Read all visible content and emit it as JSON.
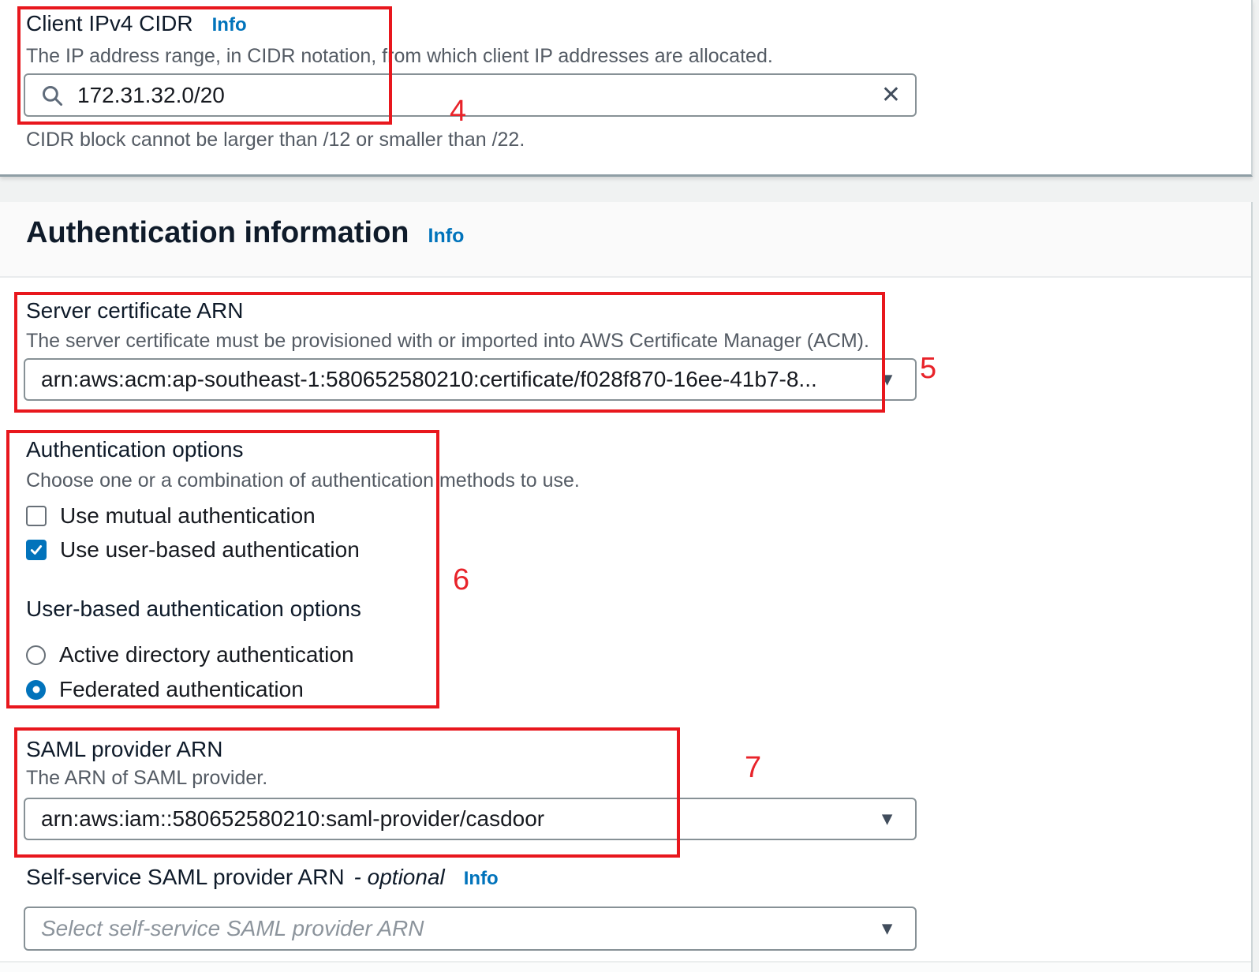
{
  "client_cidr": {
    "label": "Client IPv4 CIDR",
    "info": "Info",
    "description": "The IP address range, in CIDR notation, from which client IP addresses are allocated.",
    "value": "172.31.32.0/20",
    "hint": "CIDR block cannot be larger than /12 or smaller than /22."
  },
  "auth_section": {
    "heading": "Authentication information",
    "info": "Info"
  },
  "server_certificate": {
    "label": "Server certificate ARN",
    "description": "The server certificate must be provisioned with or imported into AWS Certificate Manager (ACM).",
    "value": "arn:aws:acm:ap-southeast-1:580652580210:certificate/f028f870-16ee-41b7-8..."
  },
  "authentication_options": {
    "label": "Authentication options",
    "description": "Choose one or a combination of authentication methods to use.",
    "checkboxes": [
      {
        "label": "Use mutual authentication",
        "checked": false
      },
      {
        "label": "Use user-based authentication",
        "checked": true
      }
    ],
    "user_based_label": "User-based authentication options",
    "radios": [
      {
        "label": "Active directory authentication",
        "selected": false
      },
      {
        "label": "Federated authentication",
        "selected": true
      }
    ]
  },
  "saml_provider": {
    "label": "SAML provider ARN",
    "description": "The ARN of SAML provider.",
    "value": "arn:aws:iam::580652580210:saml-provider/casdoor"
  },
  "self_service": {
    "label": "Self-service SAML provider ARN",
    "optional_suffix": "- optional",
    "info": "Info",
    "placeholder": "Select self-service SAML provider ARN"
  },
  "icons": {
    "dropdown_arrow": "▼",
    "clear": "✕"
  },
  "annotations": {
    "color": "#e8232a",
    "numbers": [
      "4",
      "5",
      "6",
      "7"
    ]
  }
}
